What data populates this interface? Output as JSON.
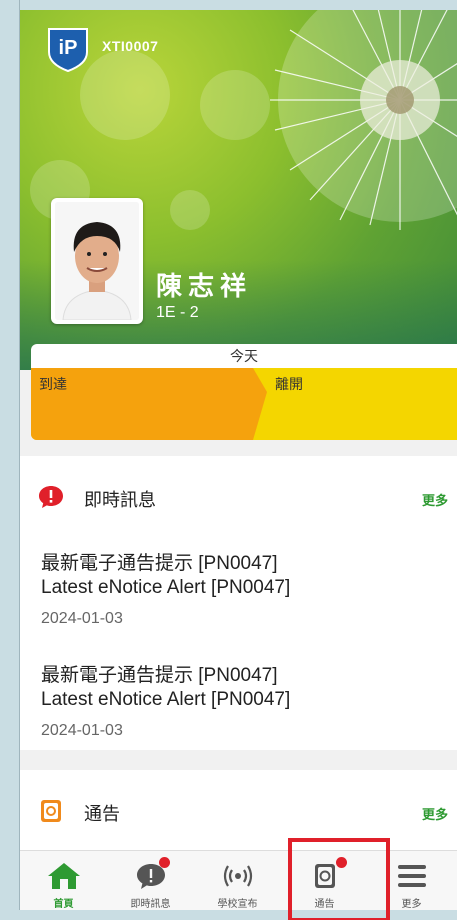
{
  "header": {
    "school_code": "XTI0007",
    "student_name": "陳志祥",
    "student_class": "1E - 2"
  },
  "attendance": {
    "date_label": "今天",
    "arrive_label": "到達",
    "leave_label": "離開"
  },
  "messages_card": {
    "title": "即時訊息",
    "more_label": "更多",
    "items": [
      {
        "title_zh": "最新電子通告提示 [PN0047]",
        "title_en": "Latest eNotice Alert [PN0047]",
        "date": "2024-01-03"
      },
      {
        "title_zh": "最新電子通告提示 [PN0047]",
        "title_en": "Latest eNotice Alert [PN0047]",
        "date": "2024-01-03"
      }
    ]
  },
  "notice_card": {
    "title": "通告",
    "more_label": "更多"
  },
  "tabbar": {
    "items": [
      {
        "label": "首頁",
        "icon": "home-icon",
        "active": true
      },
      {
        "label": "即時訊息",
        "icon": "chat-bubble-icon",
        "badge": true
      },
      {
        "label": "學校宣布",
        "icon": "broadcast-icon"
      },
      {
        "label": "通告",
        "icon": "notice-icon",
        "badge": true
      },
      {
        "label": "更多",
        "icon": "menu-icon"
      }
    ]
  },
  "colors": {
    "accent_green": "#2e9a32",
    "arrive_orange": "#f5a20d",
    "leave_yellow": "#f4d600",
    "badge_red": "#e0202a"
  }
}
